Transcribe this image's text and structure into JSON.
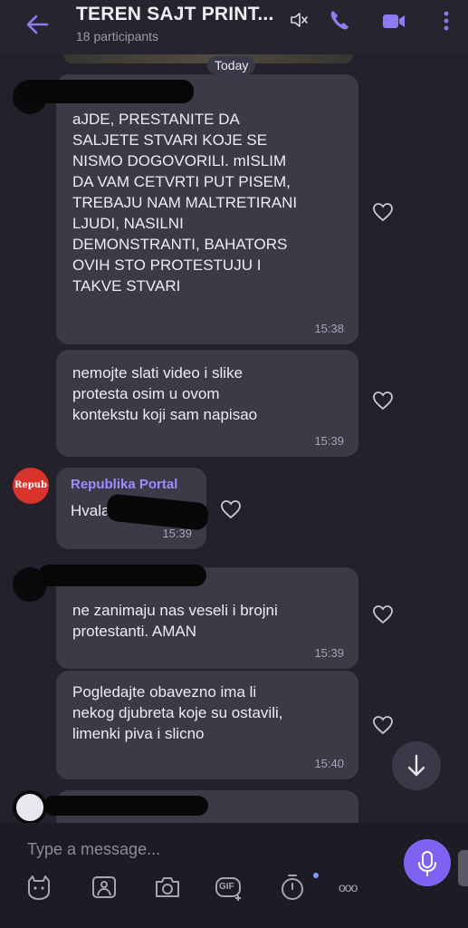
{
  "header": {
    "title": "TEREN SAJT PRINT...",
    "participants": "18 participants"
  },
  "date_divider": "Today",
  "messages": [
    {
      "text": "aJDE, PRESTANITE DA\nSALJETE STVARI KOJE SE\nNISMO DOGOVORILI. mISLIM\nDA VAM CETVRTI PUT PISEM,\nTREBAJU NAM MALTRETIRANI\nLJUDI, NASILNI\nDEMONSTRANTI, BAHATORS\nOVIH STO PROTESTUJU I\nTAKVE STVARI",
      "time": "15:38"
    },
    {
      "text": "nemojte slati video i slike\nprotesta osim u ovom\nkontekstu koji sam napisao",
      "time": "15:39"
    },
    {
      "sender": "Republika Portal",
      "avatar_text": "Repub",
      "text": "Hvala B",
      "time": "15:39"
    },
    {
      "text": "ne zanimaju nas veseli i brojni\nprotestanti. AMAN",
      "time": "15:39"
    },
    {
      "text": "Pogledajte obavezno ima li\nnekog djubreta koje su ostavili,\nlimenki piva i slicno",
      "time": "15:40"
    }
  ],
  "composer": {
    "placeholder": "Type a message...",
    "gif_label": "GIF",
    "more_label": "ooo"
  },
  "colors": {
    "background": "#23222c",
    "bubble": "#3b3a47",
    "accent": "#7e63f2",
    "sender": "#9f8cff"
  }
}
